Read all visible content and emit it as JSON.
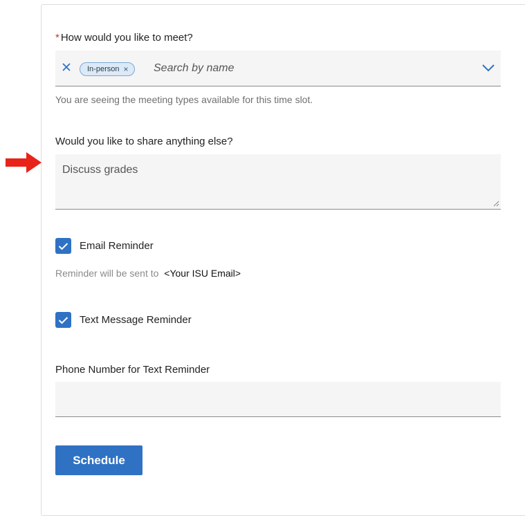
{
  "meet": {
    "required_marker": "*",
    "label": "How would you like to meet?",
    "chip_label": "In-person",
    "chip_remove_glyph": "×",
    "placeholder": "Search by name",
    "helper": "You are seeing the meeting types available for this time slot."
  },
  "share": {
    "label": "Would you like to share anything else?",
    "value": "Discuss grades"
  },
  "email_reminder": {
    "label": "Email Reminder",
    "checked": true,
    "note": "Reminder will be sent to",
    "email": "<Your ISU Email>"
  },
  "text_reminder": {
    "label": "Text Message Reminder",
    "checked": true
  },
  "phone": {
    "label": "Phone Number for Text Reminder",
    "value": ""
  },
  "schedule_button": {
    "label": "Schedule"
  },
  "colors": {
    "accent": "#2f72c4",
    "arrow": "#e8231a",
    "required": "#c0392b",
    "chip_bg": "#dce9f6"
  },
  "icons": [
    "red-arrow-icon",
    "clear-icon",
    "chevron-down-icon",
    "checkmark-icon",
    "resize-handle-icon"
  ]
}
